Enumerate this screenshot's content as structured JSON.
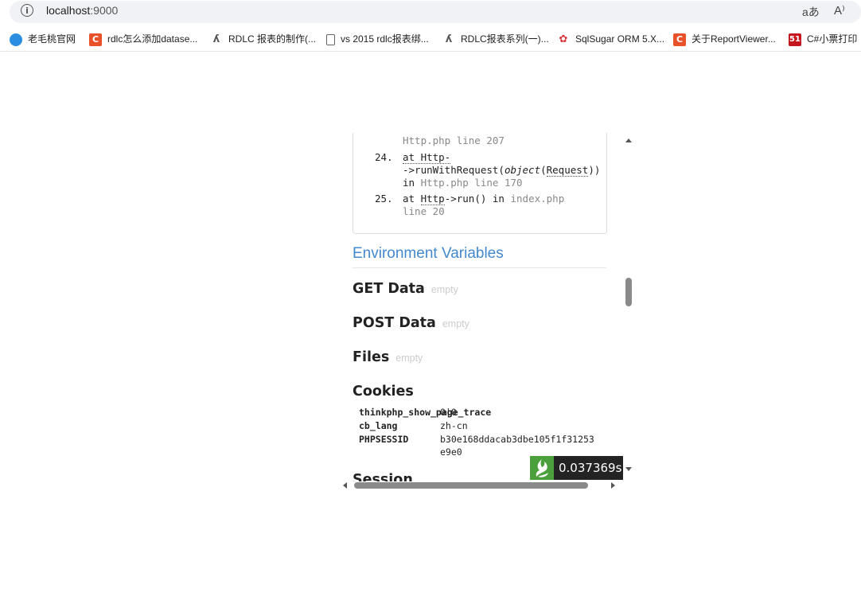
{
  "browser": {
    "url_host": "localhost",
    "url_port": ":9000",
    "translate_icon": "aあ",
    "read_aloud_icon": "A⁾"
  },
  "bookmarks": [
    {
      "label": "老毛桃官网",
      "icon": "globe-icon"
    },
    {
      "label": "rdlc怎么添加datase...",
      "icon": "csdn-icon"
    },
    {
      "label": "RDLC 报表的制作(...",
      "icon": "tool-icon"
    },
    {
      "label": "vs 2015 rdlc报表绑...",
      "icon": "document-icon"
    },
    {
      "label": "RDLC报表系列(一)...",
      "icon": "tool-icon"
    },
    {
      "label": "SqlSugar ORM 5.X...",
      "icon": "sqlsugar-icon"
    },
    {
      "label": "关于ReportViewer...",
      "icon": "csdn-icon"
    },
    {
      "label": "C#小票打印",
      "icon": "51cto-icon"
    }
  ],
  "trace": {
    "frag_top": "Http.php line 207",
    "items": [
      {
        "num": "24.",
        "l1": "at Http-",
        "l2": "->runWithRequest(",
        "obj": "object",
        "req": "Request",
        "l2end": "))",
        "l3a": "in",
        "l3b": "Http.php line 170"
      },
      {
        "num": "25.",
        "l1a": "at",
        "l1b": "Http",
        "l1c": "->run() in",
        "l1d": "index.php",
        "l2": "line 20"
      }
    ]
  },
  "env": {
    "title": "Environment Variables",
    "get": {
      "label": "GET Data",
      "empty": "empty"
    },
    "post": {
      "label": "POST Data",
      "empty": "empty"
    },
    "files": {
      "label": "Files",
      "empty": "empty"
    },
    "cookies": {
      "label": "Cookies",
      "rows": [
        {
          "key": "thinkphp_show_page_trace",
          "value": "0|0"
        },
        {
          "key": "cb_lang",
          "value": "zh-cn"
        },
        {
          "key": "PHPSESSID",
          "value": "b30e168ddacab3dbe105f1f31253",
          "value2": "e9e0"
        }
      ]
    },
    "session_label": "Session"
  },
  "page_trace_time": "0.037369s"
}
